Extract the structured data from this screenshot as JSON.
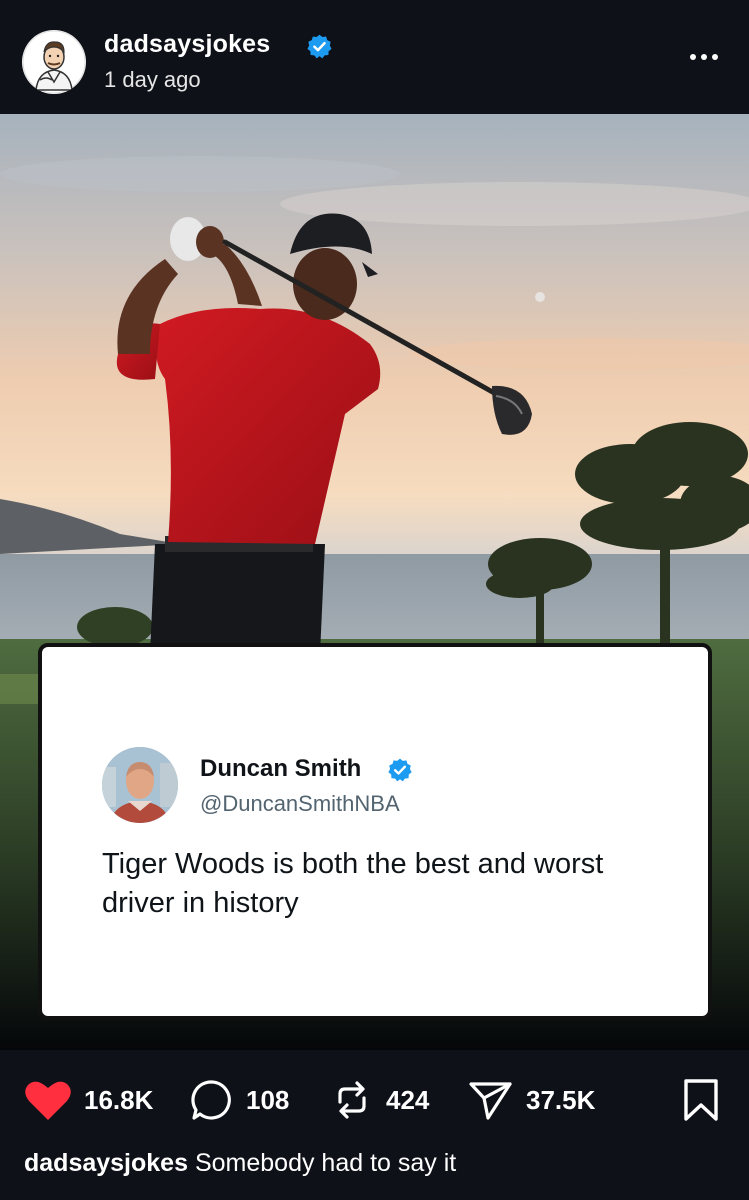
{
  "post": {
    "username": "dadsaysjokes",
    "time_ago": "1 day ago",
    "more_icon": "more-horizontal-icon"
  },
  "tweet": {
    "name": "Duncan Smith",
    "handle": "@DuncanSmithNBA",
    "text": "Tiger Woods is both the best and worst driver in history"
  },
  "actions": {
    "likes": "16.8K",
    "comments": "108",
    "reposts": "424",
    "shares": "37.5K"
  },
  "caption": {
    "username": "dadsaysjokes",
    "text": "Somebody had to say it"
  },
  "colors": {
    "background": "#0e1118",
    "like_red": "#ff2f3f",
    "verified_blue": "#1d9bf0",
    "shirt_red": "#c8141c"
  }
}
